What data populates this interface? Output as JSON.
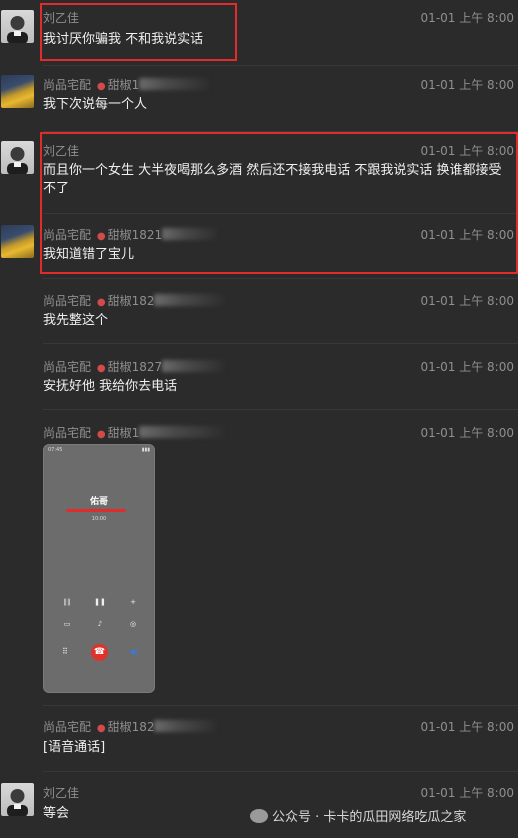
{
  "messages": [
    {
      "sender": "刘乙佳",
      "time": "01-01 上午 8:00",
      "text": "我讨厌你骗我 不和我说实话"
    },
    {
      "sender": "尚品宅配",
      "phone": "甜椒1",
      "time": "01-01 上午 8:00",
      "text": "我下次说每一个人"
    },
    {
      "sender": "刘乙佳",
      "time": "01-01 上午 8:00",
      "text": "而且你一个女生 大半夜喝那么多酒 然后还不接我电话 不跟我说实话 换谁都接受不了"
    },
    {
      "sender": "尚品宅配",
      "phone": "甜椒1821",
      "time": "01-01 上午 8:00",
      "text": "我知道错了宝儿"
    },
    {
      "sender": "尚品宅配",
      "phone": "甜椒182",
      "time": "01-01 上午 8:00",
      "text": "我先整这个"
    },
    {
      "sender": "尚品宅配",
      "phone": "甜椒1827",
      "time": "01-01 上午 8:00",
      "text": "安抚好他 我给你去电话"
    },
    {
      "sender": "尚品宅配",
      "phone": "甜椒1",
      "time": "01-01 上午 8:00",
      "text": ""
    },
    {
      "sender": "尚品宅配",
      "phone": "甜椒182",
      "time": "01-01 上午 8:00",
      "text": "[语音通话]"
    },
    {
      "sender": "刘乙佳",
      "time": "01-01 上午 8:00",
      "text": "等会"
    }
  ],
  "call_screenshot": {
    "status_time": "07:45",
    "caller_name": "佑哥",
    "duration": "10:00"
  },
  "watermark": "公众号 · 卡卡的瓜田网络吃瓜之家",
  "colors": {
    "highlight": "#e22c2c",
    "background": "#2b2b2b"
  }
}
